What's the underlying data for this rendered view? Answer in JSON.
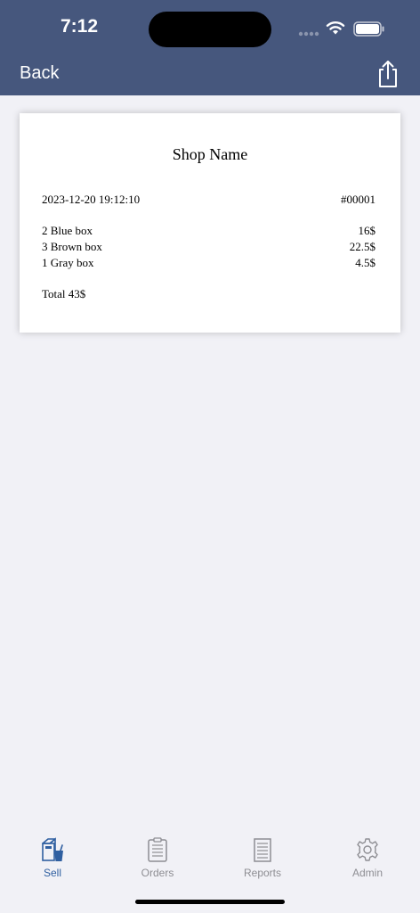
{
  "status_bar": {
    "time": "7:12"
  },
  "nav": {
    "back_label": "Back"
  },
  "receipt": {
    "shop_name": "Shop Name",
    "datetime": "2023-12-20 19:12:10",
    "order_number": "#00001",
    "items": [
      {
        "desc": "2 Blue box",
        "price": "16$"
      },
      {
        "desc": "3 Brown box",
        "price": "22.5$"
      },
      {
        "desc": "1 Gray box",
        "price": "4.5$"
      }
    ],
    "total": "Total 43$"
  },
  "tabs": [
    {
      "label": "Sell",
      "icon": "sell-icon",
      "active": true
    },
    {
      "label": "Orders",
      "icon": "orders-icon",
      "active": false
    },
    {
      "label": "Reports",
      "icon": "reports-icon",
      "active": false
    },
    {
      "label": "Admin",
      "icon": "gear-icon",
      "active": false
    }
  ],
  "colors": {
    "nav_bar": "#46577d",
    "accent": "#2f5fa0",
    "background": "#f1f1f6",
    "inactive": "#8e8e93"
  }
}
